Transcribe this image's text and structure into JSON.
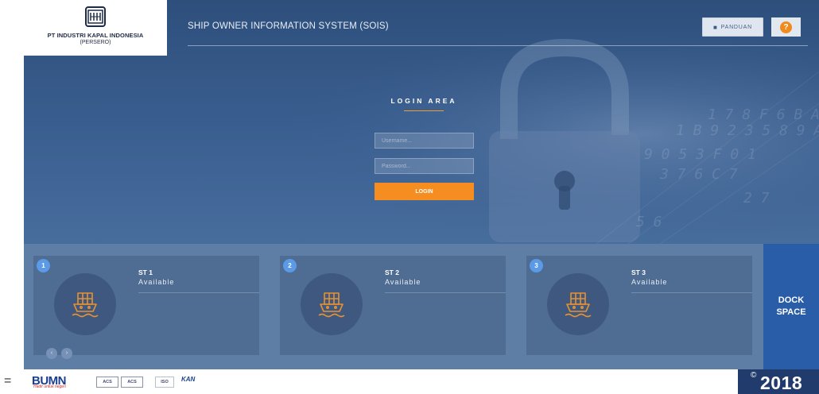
{
  "header": {
    "company_name": "PT INDUSTRI KAPAL INDONESIA",
    "company_sub": "(PERSERO)",
    "app_title": "SHIP OWNER INFORMATION SYSTEM (SOIS)",
    "panduan_label": "PANDUAN",
    "help_label": "?"
  },
  "login": {
    "title": "LOGIN AREA",
    "username_placeholder": "Username...",
    "password_placeholder": "Password...",
    "button_label": "LOGIN"
  },
  "stations": [
    {
      "number": "1",
      "name": "ST 1",
      "status": "Available"
    },
    {
      "number": "2",
      "name": "ST 2",
      "status": "Available"
    },
    {
      "number": "3",
      "name": "ST 3",
      "status": "Available"
    }
  ],
  "carousel": {
    "prev": "‹",
    "next": "›"
  },
  "dock": {
    "line1": "DOCK",
    "line2": "SPACE"
  },
  "footer": {
    "leading_mark": "=",
    "bumn": "BUMN",
    "bumn_tagline": "Hadir untuk negeri",
    "cert_1": "ACS",
    "cert_2": "ACS",
    "cert_3": "ISO",
    "kan": "KAN",
    "copyright": "©",
    "year": "2018"
  },
  "colors": {
    "accent": "#f68d20",
    "hero": "#3a5f90",
    "card": "#4f6d93",
    "dock": "#2a5da8",
    "year_badge": "#213c6c"
  },
  "icons": {
    "station_icon": "ship-container-icon",
    "panduan_icon": "book-icon",
    "help_icon": "question-icon"
  }
}
